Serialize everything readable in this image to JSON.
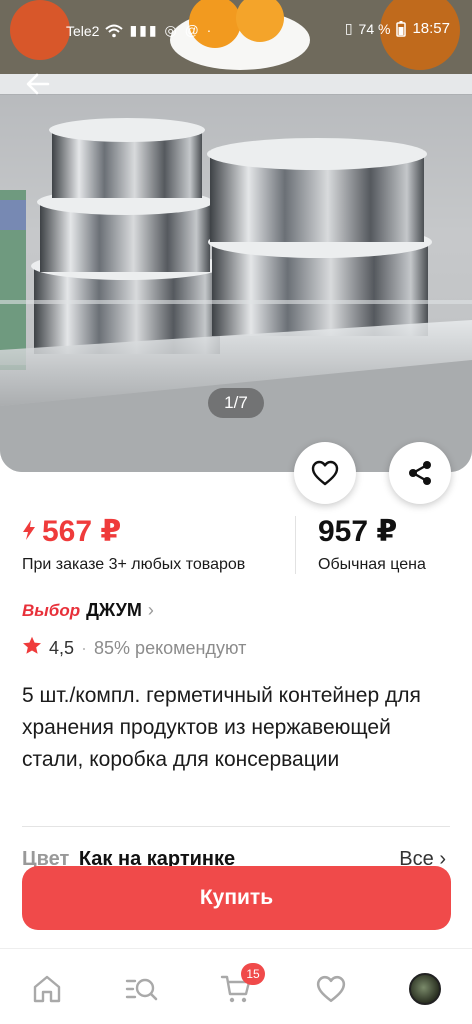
{
  "status_bar": {
    "carrier": "Tele2",
    "battery": "74 %",
    "time": "18:57"
  },
  "gallery": {
    "counter": "1/7"
  },
  "price": {
    "current": "567 ₽",
    "current_note": "При заказе 3+ любых товаров",
    "regular": "957 ₽",
    "regular_note": "Обычная цена"
  },
  "brand": {
    "badge": "Выбор",
    "name": "ДЖУМ"
  },
  "rating": {
    "value": "4,5",
    "separator": "·",
    "recommend": "85% рекомендуют"
  },
  "product": {
    "title": "5 шт./компл. герметичный контейнер для хранения продуктов из нержавеющей стали, коробка для консервации"
  },
  "options": {
    "color_label": "Цвет",
    "color_value": "Как на картинке",
    "all_label": "Все",
    "all_chevron": "›"
  },
  "actions": {
    "buy_label": "Купить"
  },
  "nav": {
    "cart_badge": "15",
    "items": [
      "home-icon",
      "catalog-search-icon",
      "cart-icon",
      "heart-icon",
      "avatar"
    ]
  },
  "colors": {
    "accent": "#f04a4a",
    "price": "#ef3b3b"
  }
}
